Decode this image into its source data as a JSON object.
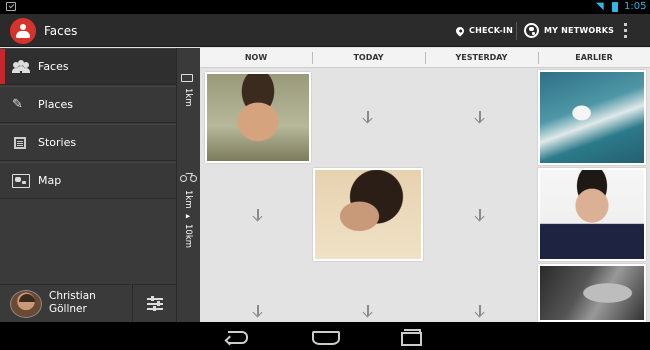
{
  "status_bar": {
    "time": "1:05"
  },
  "app": {
    "title": "Faces"
  },
  "actions": {
    "checkin_label": "CHECK-IN",
    "networks_label": "MY NETWORKS"
  },
  "sidebar": {
    "items": [
      {
        "label": "Faces",
        "icon": "people-icon",
        "active": true
      },
      {
        "label": "Places",
        "icon": "pin-icon",
        "active": false
      },
      {
        "label": "Stories",
        "icon": "stories-icon",
        "active": false
      },
      {
        "label": "Map",
        "icon": "map-icon",
        "active": false
      }
    ],
    "profile": {
      "name": "Christian Göllner"
    }
  },
  "distance_rows": [
    {
      "label": "1km",
      "icon": "walk-icon"
    },
    {
      "label": "1km ▸ 10km",
      "icon": "bike-icon"
    }
  ],
  "columns": [
    "NOW",
    "TODAY",
    "YESTERDAY",
    "EARLIER"
  ],
  "accent_color": "#c5272c"
}
